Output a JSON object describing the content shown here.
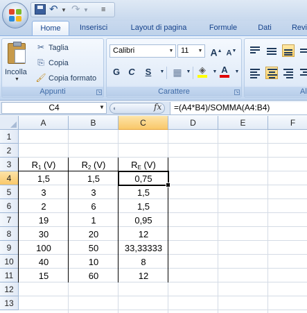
{
  "quick_access": {
    "save_icon": "save-icon",
    "undo_icon": "undo-icon",
    "redo_icon": "redo-icon",
    "more_glyph": "≡"
  },
  "tabs": [
    {
      "label": "Home",
      "active": true
    },
    {
      "label": "Inserisci"
    },
    {
      "label": "Layout di pagina"
    },
    {
      "label": "Formule"
    },
    {
      "label": "Dati"
    },
    {
      "label": "Revi"
    }
  ],
  "ribbon": {
    "clipboard": {
      "paste_label": "Incolla",
      "cut_label": "Taglia",
      "copy_label": "Copia",
      "format_painter_label": "Copia formato",
      "group_label": "Appunti"
    },
    "font": {
      "font_name": "Calibri",
      "font_size": "11",
      "bold": "G",
      "italic": "C",
      "underline": "S",
      "grow": "A",
      "shrink": "A",
      "font_color_glyph": "A",
      "group_label": "Carattere"
    },
    "alignment": {
      "group_label": "Al"
    }
  },
  "formula_bar": {
    "name_box": "C4",
    "fx": "fx",
    "formula": "=(A4*B4)/SOMMA(A4:B4)"
  },
  "grid": {
    "columns": [
      "A",
      "B",
      "C",
      "D",
      "E",
      "F"
    ],
    "rows": [
      "1",
      "2",
      "3",
      "4",
      "5",
      "6",
      "7",
      "8",
      "9",
      "10",
      "11",
      "12",
      "13"
    ],
    "active_cell": "C4",
    "headers": {
      "a_sym": "R",
      "a_sub": "1",
      "a_unit": " (V)",
      "b_sym": "R",
      "b_sub": "2",
      "b_unit": " (V)",
      "c_sym": "R",
      "c_sub": "E",
      "c_unit": " (V)"
    },
    "data": [
      [
        "1,5",
        "1,5",
        "0,75"
      ],
      [
        "3",
        "3",
        "1,5"
      ],
      [
        "2",
        "6",
        "1,5"
      ],
      [
        "19",
        "1",
        "0,95"
      ],
      [
        "30",
        "20",
        "12"
      ],
      [
        "100",
        "50",
        "33,33333"
      ],
      [
        "40",
        "10",
        "8"
      ],
      [
        "15",
        "60",
        "12"
      ]
    ]
  },
  "colors": {
    "accent": "#15428b",
    "selected_header": "#f9c86a",
    "ribbon": "#dfeaf8"
  }
}
